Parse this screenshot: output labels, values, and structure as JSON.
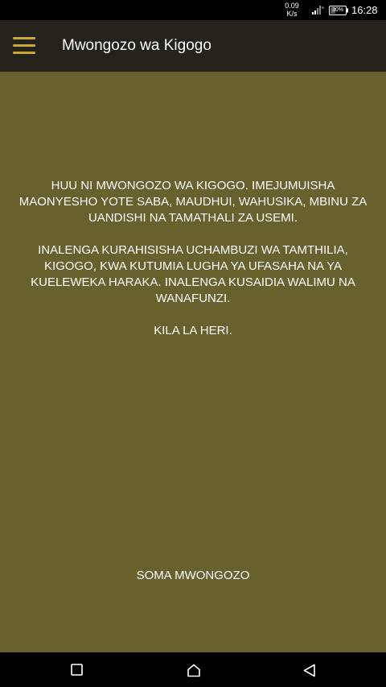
{
  "status_bar": {
    "net_speed_value": "0.09",
    "net_speed_unit": "K/s",
    "battery_label": "30%",
    "time": "16:28",
    "icons": [
      "signal-icon",
      "battery-icon"
    ]
  },
  "app_bar": {
    "menu_icon": "menu-icon",
    "title": "Mwongozo wa Kigogo"
  },
  "content": {
    "paragraphs": [
      "HUU NI MWONGOZO WA KIGOGO. IMEJUMUISHA MAONYESHO YOTE SABA, MAUDHUI, WAHUSIKA, MBINU ZA UANDISHI NA TAMATHALI ZA USEMI.",
      "INALENGA KURAHISISHA UCHAMBUZI WA TAMTHILIA, KIGOGO, KWA KUTUMIA LUGHA YA UFASAHA NA YA KUELEWEKA HARAKA. INALENGA KUSAIDIA WALIMU NA WANAFUNZI.",
      "KILA LA HERI."
    ],
    "read_button_label": "SOMA MWONGOZO"
  },
  "nav_bar": {
    "icons": [
      "recents-icon",
      "home-icon",
      "back-icon"
    ]
  },
  "colors": {
    "app_bar_bg": "#25211b",
    "content_bg": "#66612d",
    "accent": "#c8a935",
    "text": "#ffffff"
  }
}
